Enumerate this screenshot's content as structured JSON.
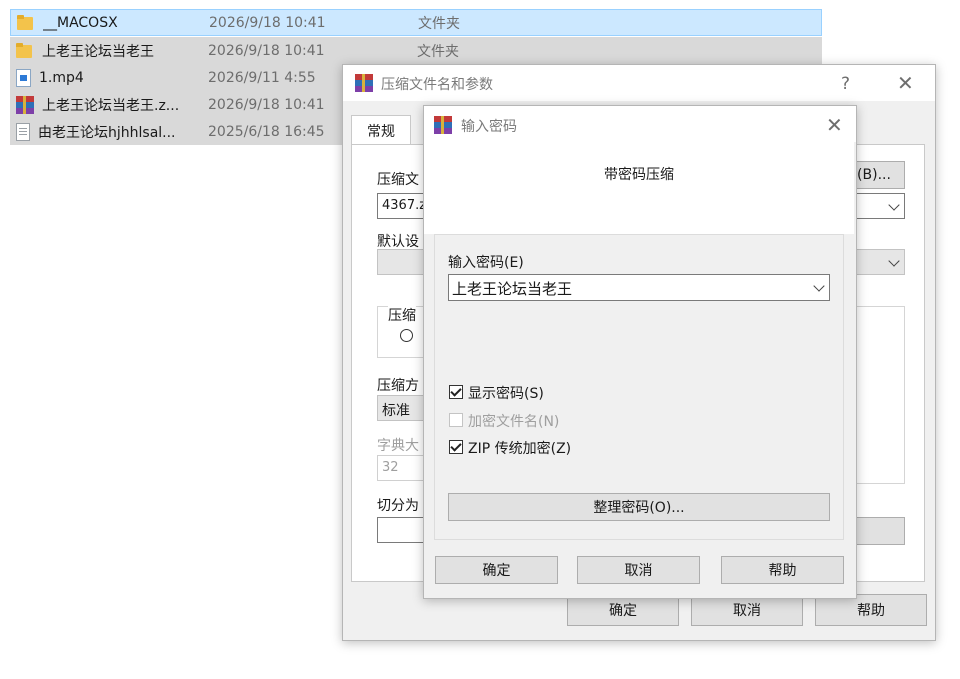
{
  "files": [
    {
      "name": "__MACOSX",
      "date": "2026/9/18 10:41",
      "type": "文件夹",
      "icon": "folder-icon"
    },
    {
      "name": "上老王论坛当老王",
      "date": "2026/9/18 10:41",
      "type": "文件夹",
      "icon": "folder-icon"
    },
    {
      "name": "1.mp4",
      "date": "2026/9/11 4:55",
      "type": "",
      "icon": "video-file-icon"
    },
    {
      "name": "上老王论坛当老王.z...",
      "date": "2026/9/18 10:41",
      "type": "",
      "icon": "archive-file-icon"
    },
    {
      "name": "由老王论坛hjhhlsal...",
      "date": "2025/6/18 16:45",
      "type": "",
      "icon": "text-file-icon"
    }
  ],
  "archive_dialog": {
    "title": "压缩文件名和参数",
    "help_glyph": "?",
    "close_glyph": "✕",
    "tab_general": "常规",
    "archive_name_label": "压缩文",
    "archive_name_value": "4367.z",
    "browse_label": "(B)...",
    "default_profile_label": "默认设",
    "format_label": "压缩",
    "method_label": "压缩方",
    "method_value": "标准",
    "dict_label": "字典大",
    "dict_value": "32",
    "split_label": "切分为",
    "ok": "确定",
    "cancel": "取消",
    "help": "帮助"
  },
  "password_dialog": {
    "title": "输入密码",
    "close_glyph": "✕",
    "heading": "带密码压缩",
    "password_label": "输入密码(E)",
    "password_value": "上老王论坛当老王",
    "show_password": "显示密码(S)",
    "show_password_checked": true,
    "encrypt_filenames": "加密文件名(N)",
    "encrypt_filenames_checked": false,
    "zip_legacy": "ZIP 传统加密(Z)",
    "zip_legacy_checked": true,
    "organize": "整理密码(O)...",
    "ok": "确定",
    "cancel": "取消",
    "help": "帮助"
  }
}
